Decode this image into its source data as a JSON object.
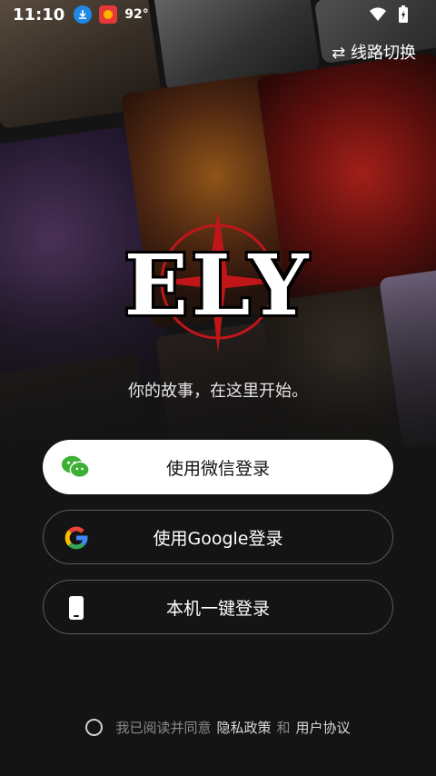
{
  "status_bar": {
    "time": "11:10",
    "temperature": "92°",
    "icons": [
      "download-icon",
      "app-icon",
      "wifi-icon",
      "battery-icon"
    ]
  },
  "header": {
    "line_switch_label": "⇄ 线路切换"
  },
  "brand": {
    "logo_text": "ELY",
    "tagline": "你的故事，在这里开始。"
  },
  "login": {
    "wechat_label": "使用微信登录",
    "google_label": "使用Google登录",
    "phone_label": "本机一键登录"
  },
  "agreement": {
    "prefix": "我已阅读并同意",
    "privacy_label": "隐私政策",
    "and": "和",
    "terms_label": "用户协议"
  },
  "colors": {
    "background": "#141414",
    "wechat_green": "#3cb034",
    "button_border": "#5a5a5a"
  }
}
